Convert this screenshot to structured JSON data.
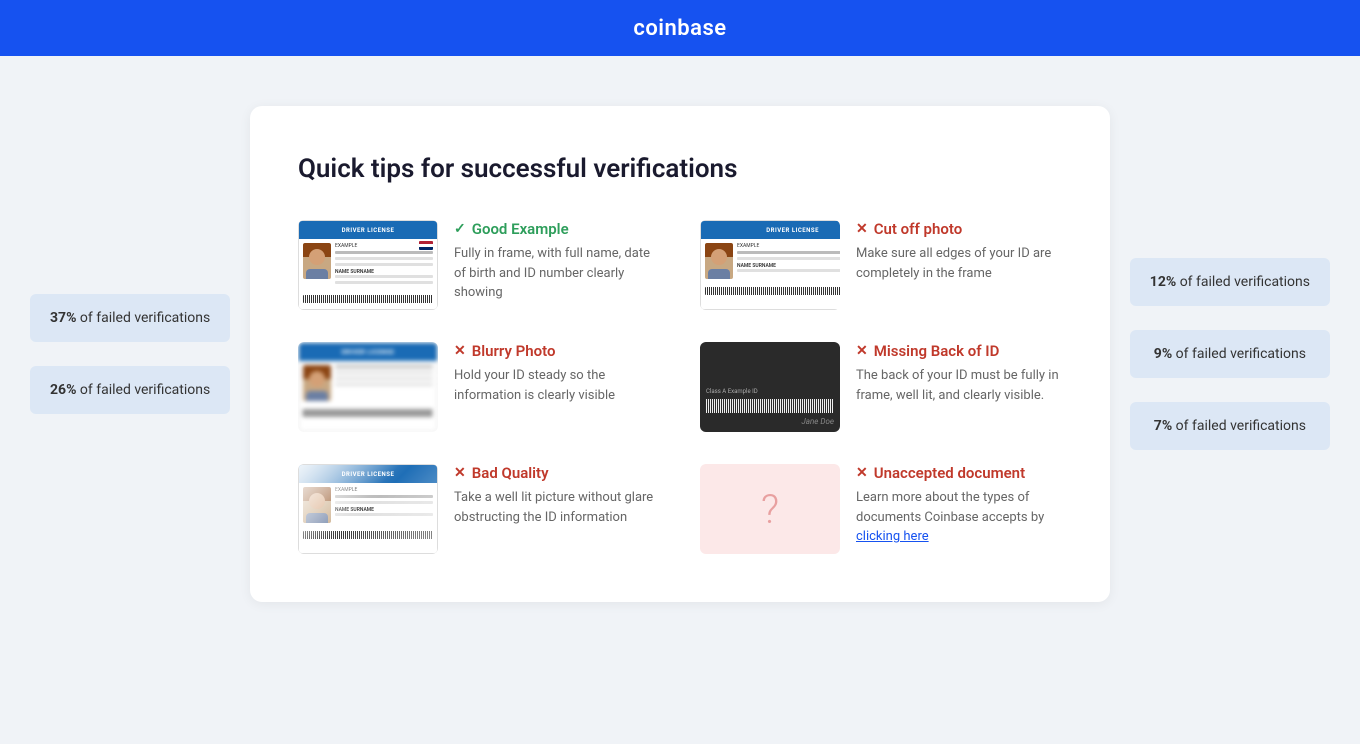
{
  "header": {
    "logo": "coinbase"
  },
  "left_badges": [
    {
      "percent": "37%",
      "label": "of failed verifications"
    },
    {
      "percent": "26%",
      "label": "of failed verifications"
    }
  ],
  "right_badges": [
    {
      "percent": "12%",
      "label": "of failed verifications"
    },
    {
      "percent": "9%",
      "label": "of failed verifications"
    },
    {
      "percent": "7%",
      "label": "of failed verifications"
    }
  ],
  "card": {
    "title": "Quick tips for successful verifications",
    "tips": [
      {
        "id": "good-example",
        "status": "good",
        "status_icon": "✓",
        "label": "Good Example",
        "description": "Fully in frame, with full name, date of birth and ID number clearly showing",
        "image_type": "id-good"
      },
      {
        "id": "cut-off-photo",
        "status": "bad",
        "status_icon": "✕",
        "label": "Cut off photo",
        "description": "Make sure all edges of your ID are completely in the frame",
        "image_type": "id-cutoff"
      },
      {
        "id": "blurry-photo",
        "status": "bad",
        "status_icon": "✕",
        "label": "Blurry Photo",
        "description": "Hold your ID steady so the information is clearly visible",
        "image_type": "id-blurry"
      },
      {
        "id": "missing-back",
        "status": "bad",
        "status_icon": "✕",
        "label": "Missing Back of ID",
        "description": "The back of your ID must be fully in frame, well lit, and clearly visible.",
        "image_type": "id-back"
      },
      {
        "id": "bad-quality",
        "status": "bad",
        "status_icon": "✕",
        "label": "Bad Quality",
        "description": "Take a well lit picture without glare obstructing the ID information",
        "image_type": "id-glare"
      },
      {
        "id": "unaccepted-document",
        "status": "bad",
        "status_icon": "✕",
        "label": "Unaccepted document",
        "description_pre": "Learn more about the types of documents Coinbase accepts by ",
        "link_text": "clicking here",
        "description_post": "",
        "image_type": "id-unaccepted"
      }
    ]
  }
}
